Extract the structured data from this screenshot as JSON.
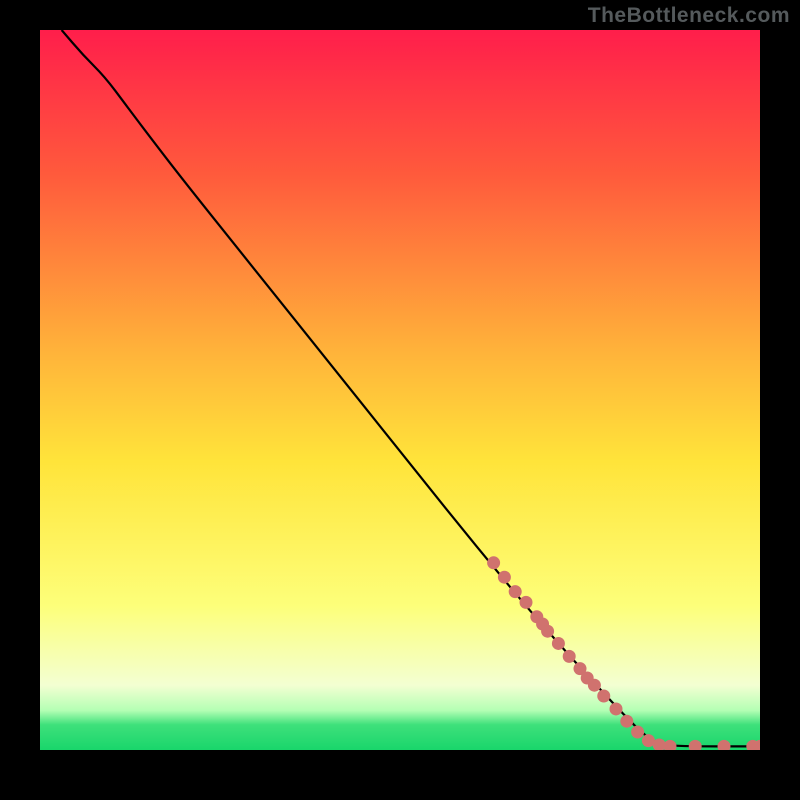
{
  "watermark": "TheBottleneck.com",
  "colors": {
    "curve": "#000000",
    "marker": "#d0726e",
    "frame_bg": "#000000"
  },
  "chart_data": {
    "type": "line",
    "title": "",
    "xlabel": "",
    "ylabel": "",
    "xlim": [
      0,
      100
    ],
    "ylim": [
      0,
      100
    ],
    "gradient_stops": [
      {
        "offset": 0.0,
        "color": "#ff1e4b"
      },
      {
        "offset": 0.2,
        "color": "#ff5a3c"
      },
      {
        "offset": 0.45,
        "color": "#ffb43a"
      },
      {
        "offset": 0.6,
        "color": "#ffe43a"
      },
      {
        "offset": 0.8,
        "color": "#fdff7a"
      },
      {
        "offset": 0.91,
        "color": "#f3ffd2"
      },
      {
        "offset": 0.945,
        "color": "#b4ffb4"
      },
      {
        "offset": 0.965,
        "color": "#3ee07b"
      },
      {
        "offset": 1.0,
        "color": "#19d66b"
      }
    ],
    "curve": [
      {
        "x": 3.0,
        "y": 100.0
      },
      {
        "x": 6.0,
        "y": 96.5
      },
      {
        "x": 9.0,
        "y": 93.5
      },
      {
        "x": 12.0,
        "y": 89.5
      },
      {
        "x": 15.0,
        "y": 85.5
      },
      {
        "x": 20.0,
        "y": 79.0
      },
      {
        "x": 30.0,
        "y": 66.5
      },
      {
        "x": 40.0,
        "y": 54.0
      },
      {
        "x": 50.0,
        "y": 41.5
      },
      {
        "x": 60.0,
        "y": 29.0
      },
      {
        "x": 70.0,
        "y": 17.0
      },
      {
        "x": 80.0,
        "y": 6.0
      },
      {
        "x": 85.0,
        "y": 1.0
      },
      {
        "x": 88.0,
        "y": 0.5
      },
      {
        "x": 100.0,
        "y": 0.5
      }
    ],
    "markers": [
      {
        "x": 63.0,
        "y": 26.0
      },
      {
        "x": 64.5,
        "y": 24.0
      },
      {
        "x": 66.0,
        "y": 22.0
      },
      {
        "x": 67.5,
        "y": 20.5
      },
      {
        "x": 69.0,
        "y": 18.5
      },
      {
        "x": 69.8,
        "y": 17.5
      },
      {
        "x": 70.5,
        "y": 16.5
      },
      {
        "x": 72.0,
        "y": 14.8
      },
      {
        "x": 73.5,
        "y": 13.0
      },
      {
        "x": 75.0,
        "y": 11.3
      },
      {
        "x": 76.0,
        "y": 10.0
      },
      {
        "x": 77.0,
        "y": 9.0
      },
      {
        "x": 78.3,
        "y": 7.5
      },
      {
        "x": 80.0,
        "y": 5.7
      },
      {
        "x": 81.5,
        "y": 4.0
      },
      {
        "x": 83.0,
        "y": 2.5
      },
      {
        "x": 84.5,
        "y": 1.3
      },
      {
        "x": 86.0,
        "y": 0.7
      },
      {
        "x": 87.5,
        "y": 0.5
      },
      {
        "x": 91.0,
        "y": 0.5
      },
      {
        "x": 95.0,
        "y": 0.5
      },
      {
        "x": 99.0,
        "y": 0.5
      },
      {
        "x": 100.0,
        "y": 0.5
      }
    ]
  }
}
